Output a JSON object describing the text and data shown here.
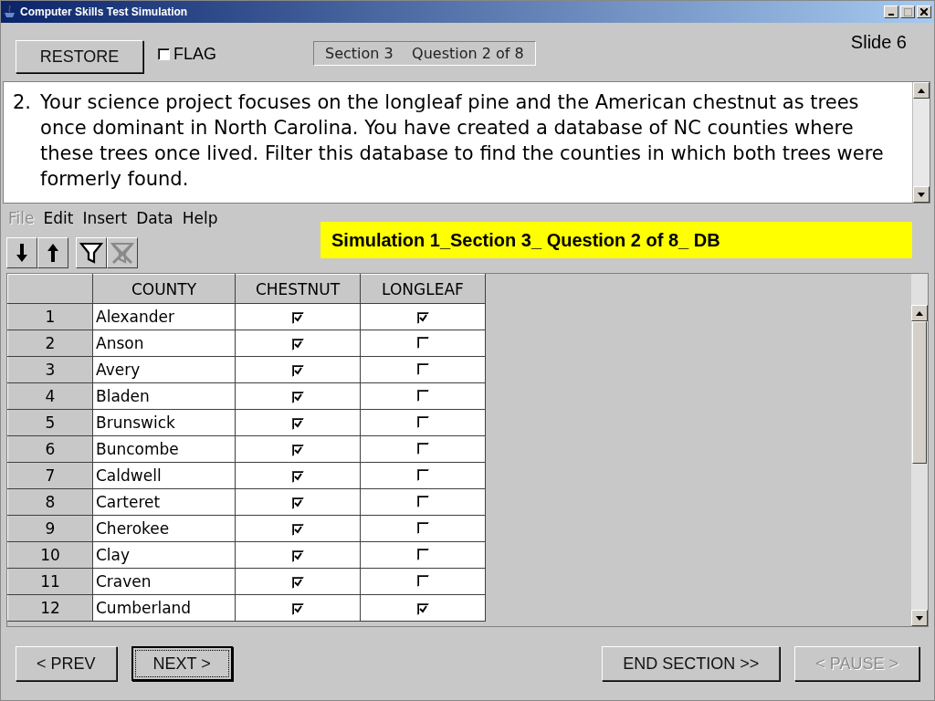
{
  "window": {
    "title": "Computer Skills Test Simulation"
  },
  "top_bar": {
    "restore_button": "RESTORE",
    "flag": {
      "label": "FLAG",
      "checked": false
    },
    "section_info": "Section 3    Question 2 of 8",
    "slide_label": "Slide 6"
  },
  "question": {
    "number": "2.",
    "text": "Your science project focuses on the longleaf pine and the American chestnut as trees once dominant in North Carolina. You have created a database of NC counties where these trees once lived. Filter this database to find the counties in which both trees were formerly found."
  },
  "menu": [
    {
      "label": "File",
      "disabled": true
    },
    {
      "label": "Edit",
      "disabled": false
    },
    {
      "label": "Insert",
      "disabled": false
    },
    {
      "label": "Data",
      "disabled": false
    },
    {
      "label": "Help",
      "disabled": false
    }
  ],
  "toolbar": [
    {
      "kind": "sort-descending",
      "disabled": false
    },
    {
      "kind": "sort-ascending",
      "disabled": false
    },
    {
      "kind": "filter",
      "disabled": false
    },
    {
      "kind": "remove-filter",
      "disabled": true
    }
  ],
  "banner": "Simulation 1_Section 3_ Question 2 of 8_ DB",
  "table": {
    "columns": [
      "COUNTY",
      "CHESTNUT",
      "LONGLEAF"
    ],
    "rows": [
      {
        "number": "1",
        "county": "Alexander",
        "chestnut": true,
        "longleaf": true
      },
      {
        "number": "2",
        "county": "Anson",
        "chestnut": true,
        "longleaf": false
      },
      {
        "number": "3",
        "county": "Avery",
        "chestnut": true,
        "longleaf": false
      },
      {
        "number": "4",
        "county": "Bladen",
        "chestnut": true,
        "longleaf": false
      },
      {
        "number": "5",
        "county": "Brunswick",
        "chestnut": true,
        "longleaf": false
      },
      {
        "number": "6",
        "county": "Buncombe",
        "chestnut": true,
        "longleaf": false
      },
      {
        "number": "7",
        "county": "Caldwell",
        "chestnut": true,
        "longleaf": false
      },
      {
        "number": "8",
        "county": "Carteret",
        "chestnut": true,
        "longleaf": false
      },
      {
        "number": "9",
        "county": "Cherokee",
        "chestnut": true,
        "longleaf": false
      },
      {
        "number": "10",
        "county": "Clay",
        "chestnut": true,
        "longleaf": false
      },
      {
        "number": "11",
        "county": "Craven",
        "chestnut": true,
        "longleaf": false
      },
      {
        "number": "12",
        "county": "Cumberland",
        "chestnut": true,
        "longleaf": true
      }
    ]
  },
  "buttons": [
    {
      "label": "< PREV",
      "focused": false,
      "disabled": false
    },
    {
      "label": "NEXT >",
      "focused": true,
      "disabled": false
    },
    {
      "label": "END SECTION >>",
      "focused": false,
      "disabled": false
    },
    {
      "label": "< PAUSE >",
      "focused": false,
      "disabled": true
    }
  ]
}
